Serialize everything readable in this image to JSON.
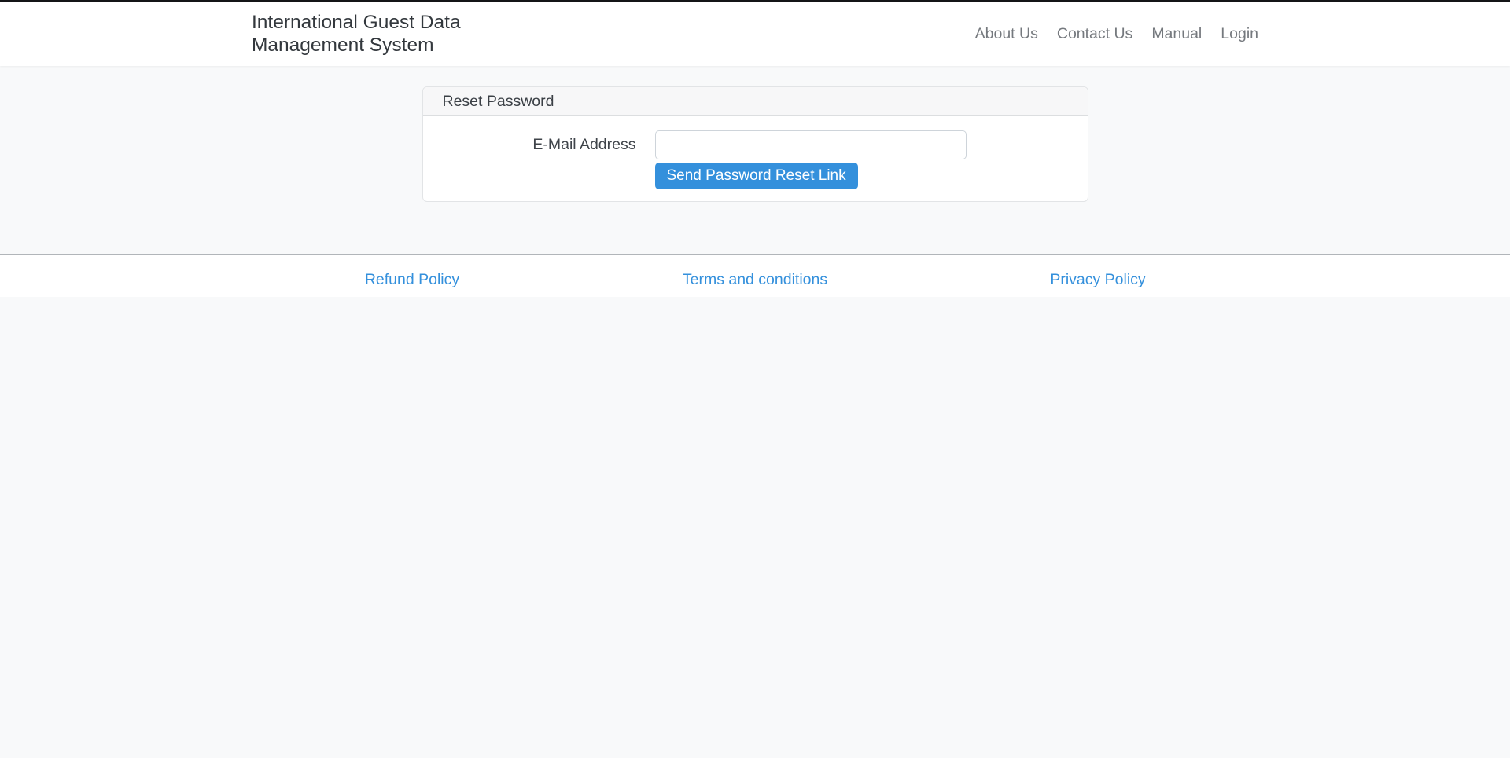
{
  "colors": {
    "primary_blue": "#3490dc",
    "page_background": "#f8f9fa",
    "navbar_background": "#ffffff",
    "footer_link_blue": "#3490dc"
  },
  "navbar": {
    "brand_line1": "International Guest Data",
    "brand_line2": "Management System",
    "items": [
      {
        "label": "About Us"
      },
      {
        "label": "Contact Us"
      },
      {
        "label": "Manual"
      },
      {
        "label": "Login"
      }
    ]
  },
  "reset_card": {
    "header_title": "Reset Password",
    "email_label": "E-Mail Address",
    "email_value": "",
    "submit_label": "Send Password Reset Link"
  },
  "footer": {
    "links": [
      {
        "label": "Refund Policy"
      },
      {
        "label": "Terms and conditions"
      },
      {
        "label": "Privacy Policy"
      }
    ]
  }
}
